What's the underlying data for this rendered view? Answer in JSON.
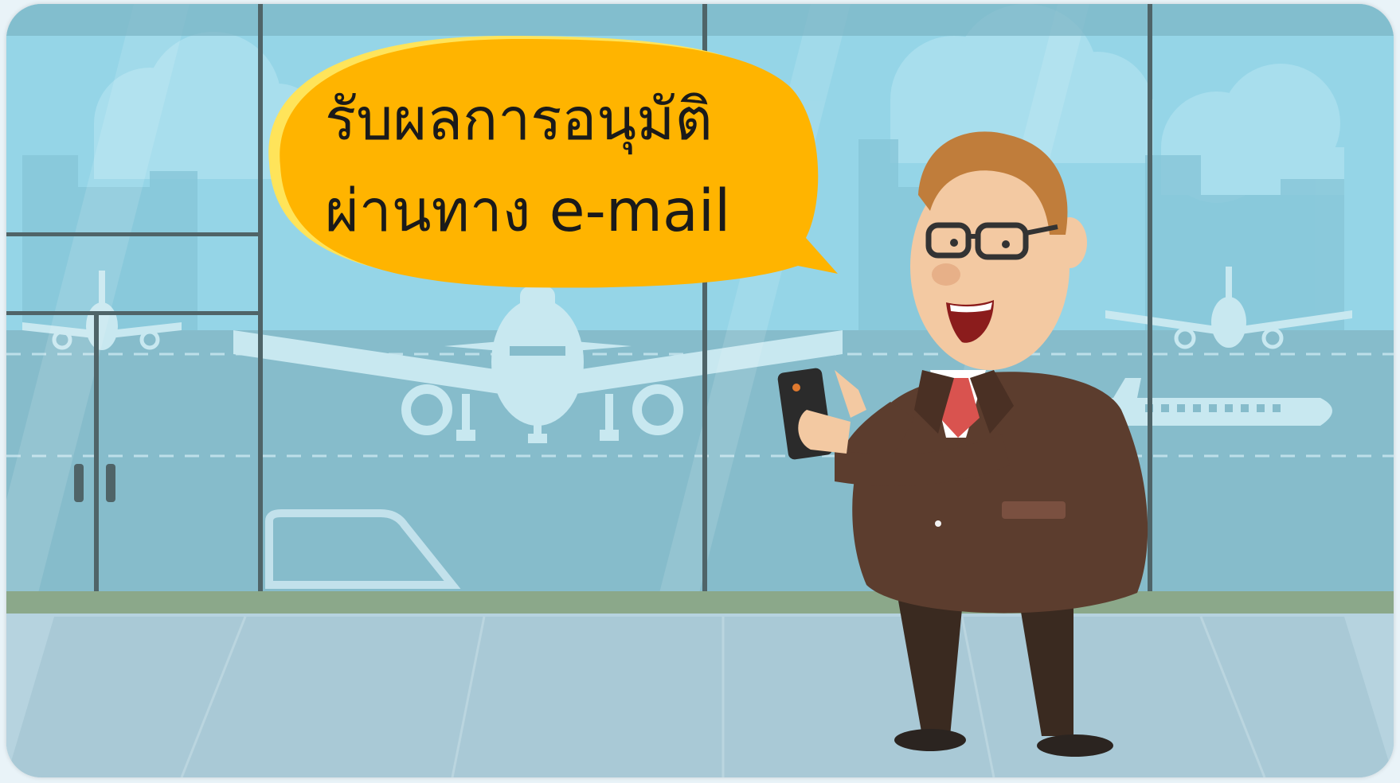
{
  "speech": {
    "line1": "รับผลการอนุมัติ",
    "line2": "ผ่านทาง e-mail"
  },
  "colors": {
    "sky": "#8fd3e6",
    "bubble": "#ffb400",
    "suit": "#5c3d2e",
    "window_frame": "#4f6468"
  },
  "icons": {
    "phone": "smartphone-icon",
    "airplane": "airplane-icon"
  }
}
